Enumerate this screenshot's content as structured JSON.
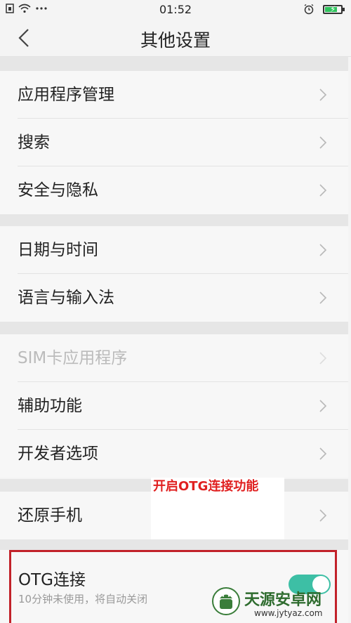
{
  "status_bar": {
    "time": "01:52",
    "icons": [
      "sim-icon",
      "wifi-icon",
      "more-dots-icon",
      "alarm-icon",
      "battery-charging-icon"
    ]
  },
  "header": {
    "title": "其他设置",
    "back_icon": "chevron-left-icon"
  },
  "groups": [
    {
      "items": [
        {
          "label": "应用程序管理",
          "enabled": true
        },
        {
          "label": "搜索",
          "enabled": true
        },
        {
          "label": "安全与隐私",
          "enabled": true
        }
      ]
    },
    {
      "items": [
        {
          "label": "日期与时间",
          "enabled": true
        },
        {
          "label": "语言与输入法",
          "enabled": true
        }
      ]
    },
    {
      "items": [
        {
          "label": "SIM卡应用程序",
          "enabled": false
        },
        {
          "label": "辅助功能",
          "enabled": true
        },
        {
          "label": "开发者选项",
          "enabled": true
        }
      ]
    },
    {
      "items": [
        {
          "label": "还原手机",
          "enabled": true
        }
      ]
    }
  ],
  "annotation": {
    "text": "开启OTG连接功能",
    "color": "#e02020"
  },
  "otg": {
    "title": "OTG连接",
    "subtitle": "10分钟未使用，将自动关闭",
    "enabled": true,
    "toggle_color": "#3dbfa5",
    "highlight_color": "#c2222a"
  },
  "watermark": {
    "title": "天源安卓网",
    "url": "www.jytyaz.com"
  }
}
